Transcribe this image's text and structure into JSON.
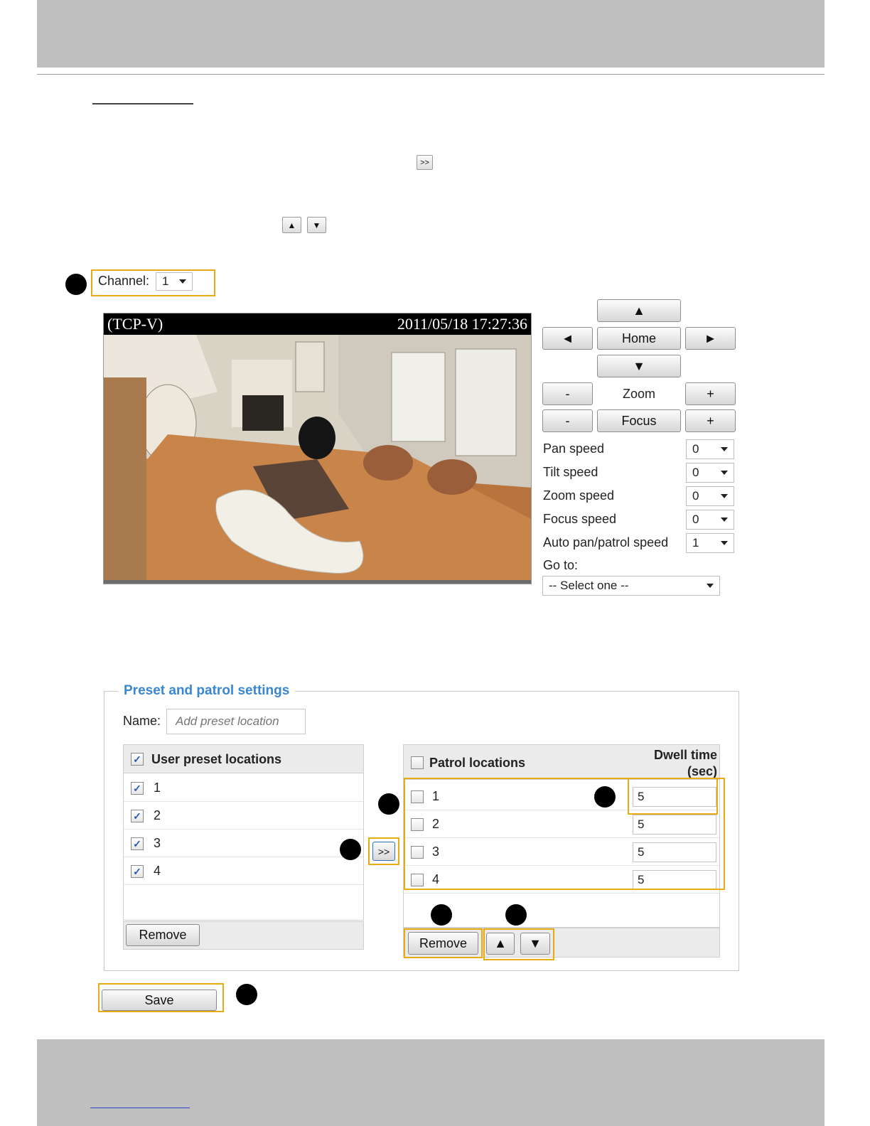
{
  "inline_buttons": {
    "add_label": ">>",
    "up_label": "▲",
    "down_label": "▼"
  },
  "channel": {
    "label": "Channel:",
    "value": "1"
  },
  "video": {
    "protocol": "(TCP-V)",
    "timestamp": "2011/05/18 17:27:36"
  },
  "ptz": {
    "up_label": "▲",
    "left_label": "◄",
    "home_label": "Home",
    "right_label": "►",
    "down_label": "▼",
    "zoom_label": "Zoom",
    "focus_label": "Focus",
    "minus_label": "-",
    "plus_label": "+"
  },
  "speeds": [
    {
      "label": "Pan speed",
      "value": "0"
    },
    {
      "label": "Tilt speed",
      "value": "0"
    },
    {
      "label": "Zoom speed",
      "value": "0"
    },
    {
      "label": "Focus speed",
      "value": "0"
    },
    {
      "label": "Auto pan/patrol speed",
      "value": "1"
    }
  ],
  "goto": {
    "label": "Go to:",
    "value": "-- Select one --"
  },
  "preset": {
    "legend": "Preset and patrol settings",
    "name_label": "Name:",
    "name_placeholder": "Add preset location",
    "user_header": "User preset locations",
    "user_items": [
      "1",
      "2",
      "3",
      "4"
    ],
    "remove_label": "Remove",
    "add_label": ">>",
    "patrol_header": "Patrol locations",
    "dwell_header_1": "Dwell time",
    "dwell_header_2": "(sec)",
    "patrol_items": [
      {
        "name": "1",
        "dwell": "5"
      },
      {
        "name": "2",
        "dwell": "5"
      },
      {
        "name": "3",
        "dwell": "5"
      },
      {
        "name": "4",
        "dwell": "5"
      }
    ],
    "patrol_remove_label": "Remove",
    "move_up_label": "▲",
    "move_down_label": "▼"
  },
  "save_label": "Save",
  "colors": {
    "highlight": "#e8ac12",
    "legend": "#3a86cf",
    "callout": "#000000",
    "header_bar": "#bfbfbf"
  }
}
